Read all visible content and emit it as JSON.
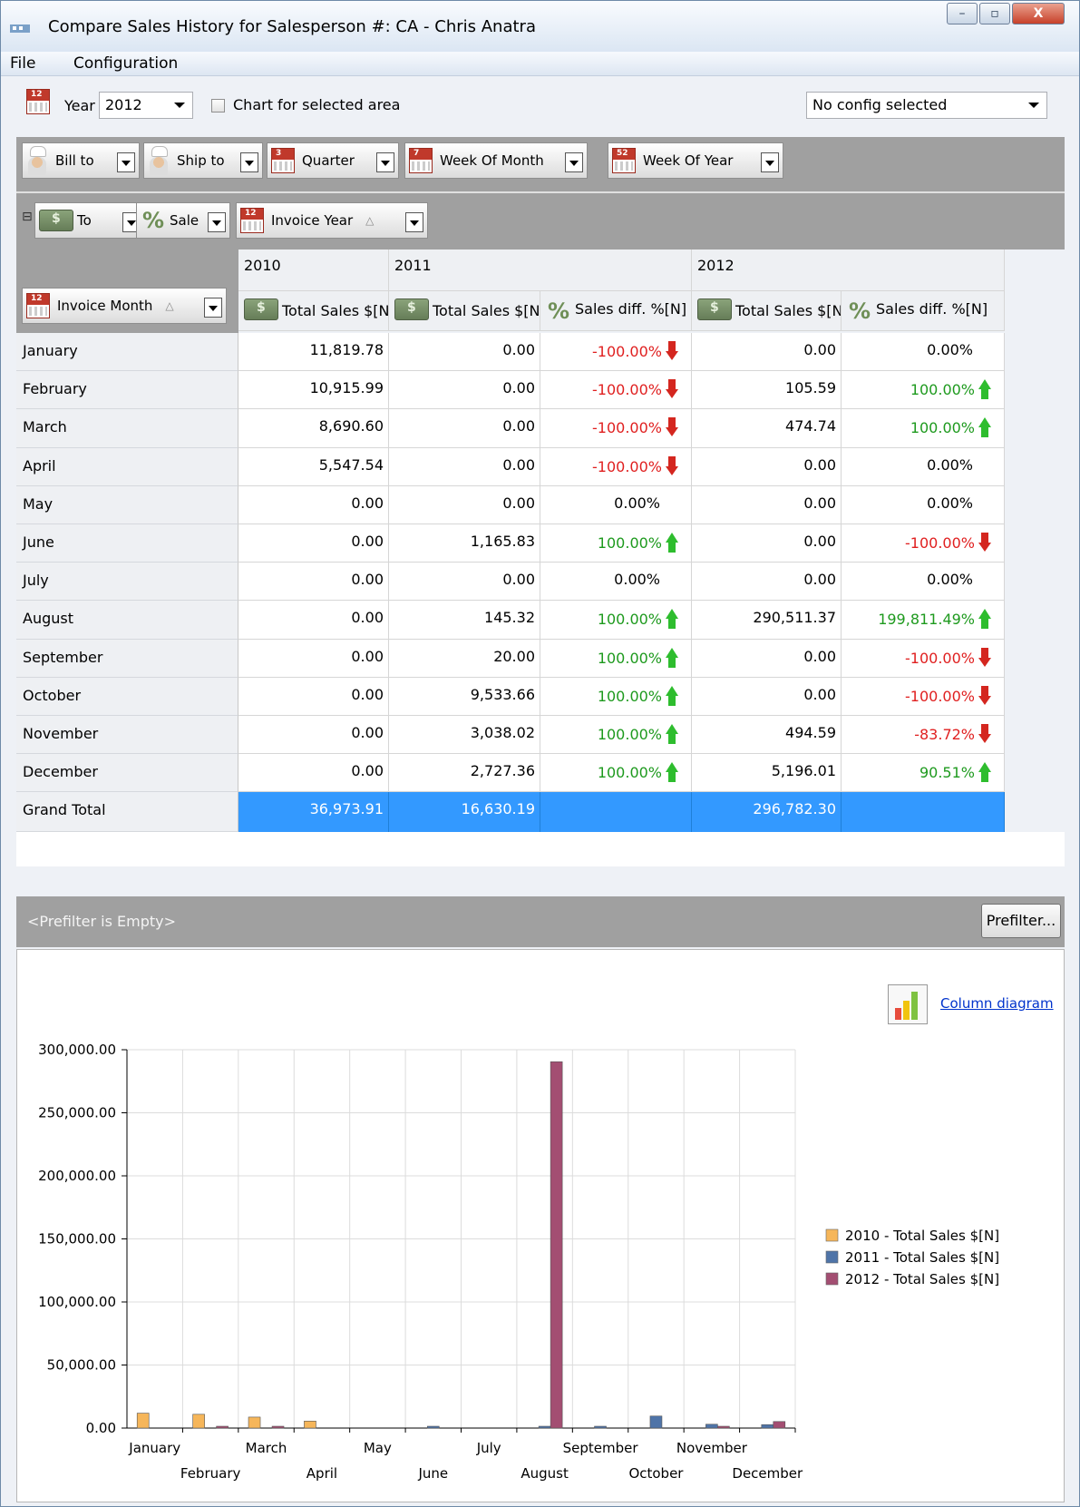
{
  "window": {
    "title": "Compare Sales History for Salesperson #: CA - Chris Anatra",
    "minimize_glyph": "–",
    "maximize_glyph": "▫",
    "close_glyph": "X"
  },
  "menu": {
    "file": "File",
    "configuration": "Configuration"
  },
  "toolbar": {
    "year_label": "Year",
    "year_value": "2012",
    "chart_selected_label": "Chart for selected area",
    "config_value": "No config selected"
  },
  "filter_fields": [
    {
      "label": "Bill to",
      "icon": "person-icon"
    },
    {
      "label": "Ship to",
      "icon": "person-icon"
    },
    {
      "label": "Quarter",
      "icon": "calendar-icon",
      "icon_text": "3"
    },
    {
      "label": "Week Of Month",
      "icon": "calendar-icon",
      "icon_text": "7"
    },
    {
      "label": "Week Of Year",
      "icon": "calendar-icon",
      "icon_text": "52"
    }
  ],
  "data_fields": {
    "collapse_glyph": "⊟",
    "total_short": "To",
    "sales_short": "Sale",
    "invoice_year": "Invoice Year",
    "invoice_month": "Invoice Month",
    "sort_glyph": "△"
  },
  "calendar_icon_text": "12",
  "pivot": {
    "years": [
      "2010",
      "2011",
      "2012"
    ],
    "measure_headers": [
      "Total Sales $[N]",
      "Total Sales $[N]",
      "Sales diff. %[N]",
      "Total Sales $[N]",
      "Sales diff. %[N]"
    ],
    "rows": [
      {
        "month": "January",
        "t2010": "11,819.78",
        "t2011": "0.00",
        "d2011": "-100.00%",
        "d2011_dir": "down",
        "t2012": "0.00",
        "d2012": "0.00%",
        "d2012_dir": "none"
      },
      {
        "month": "February",
        "t2010": "10,915.99",
        "t2011": "0.00",
        "d2011": "-100.00%",
        "d2011_dir": "down",
        "t2012": "105.59",
        "d2012": "100.00%",
        "d2012_dir": "up"
      },
      {
        "month": "March",
        "t2010": "8,690.60",
        "t2011": "0.00",
        "d2011": "-100.00%",
        "d2011_dir": "down",
        "t2012": "474.74",
        "d2012": "100.00%",
        "d2012_dir": "up"
      },
      {
        "month": "April",
        "t2010": "5,547.54",
        "t2011": "0.00",
        "d2011": "-100.00%",
        "d2011_dir": "down",
        "t2012": "0.00",
        "d2012": "0.00%",
        "d2012_dir": "none"
      },
      {
        "month": "May",
        "t2010": "0.00",
        "t2011": "0.00",
        "d2011": "0.00%",
        "d2011_dir": "none",
        "t2012": "0.00",
        "d2012": "0.00%",
        "d2012_dir": "none"
      },
      {
        "month": "June",
        "t2010": "0.00",
        "t2011": "1,165.83",
        "d2011": "100.00%",
        "d2011_dir": "up",
        "t2012": "0.00",
        "d2012": "-100.00%",
        "d2012_dir": "down"
      },
      {
        "month": "July",
        "t2010": "0.00",
        "t2011": "0.00",
        "d2011": "0.00%",
        "d2011_dir": "none",
        "t2012": "0.00",
        "d2012": "0.00%",
        "d2012_dir": "none"
      },
      {
        "month": "August",
        "t2010": "0.00",
        "t2011": "145.32",
        "d2011": "100.00%",
        "d2011_dir": "up",
        "t2012": "290,511.37",
        "d2012": "199,811.49%",
        "d2012_dir": "up"
      },
      {
        "month": "September",
        "t2010": "0.00",
        "t2011": "20.00",
        "d2011": "100.00%",
        "d2011_dir": "up",
        "t2012": "0.00",
        "d2012": "-100.00%",
        "d2012_dir": "down"
      },
      {
        "month": "October",
        "t2010": "0.00",
        "t2011": "9,533.66",
        "d2011": "100.00%",
        "d2011_dir": "up",
        "t2012": "0.00",
        "d2012": "-100.00%",
        "d2012_dir": "down"
      },
      {
        "month": "November",
        "t2010": "0.00",
        "t2011": "3,038.02",
        "d2011": "100.00%",
        "d2011_dir": "up",
        "t2012": "494.59",
        "d2012": "-83.72%",
        "d2012_dir": "down"
      },
      {
        "month": "December",
        "t2010": "0.00",
        "t2011": "2,727.36",
        "d2011": "100.00%",
        "d2011_dir": "up",
        "t2012": "5,196.01",
        "d2012": "90.51%",
        "d2012_dir": "up"
      }
    ],
    "grand_total": {
      "label": "Grand Total",
      "t2010": "36,973.91",
      "t2011": "16,630.19",
      "t2012": "296,782.30"
    }
  },
  "prefilter": {
    "status": "<Prefilter is Empty>",
    "button": "Prefilter..."
  },
  "chart_type_link": "Column diagram",
  "colors": {
    "s2010": "#f6b65a",
    "s2011": "#4f74a8",
    "s2012": "#a34e72",
    "neg": "#e02020",
    "pos": "#1e9a1e",
    "selection": "#3399ff"
  },
  "chart_data": {
    "type": "bar",
    "categories": [
      "January",
      "February",
      "March",
      "April",
      "May",
      "June",
      "July",
      "August",
      "September",
      "October",
      "November",
      "December"
    ],
    "series": [
      {
        "name": "2010 - Total Sales $[N]",
        "values": [
          11819.78,
          10915.99,
          8690.6,
          5547.54,
          0,
          0,
          0,
          0,
          0,
          0,
          0,
          0
        ]
      },
      {
        "name": "2011 - Total Sales $[N]",
        "values": [
          0,
          0,
          0,
          0,
          0,
          1165.83,
          0,
          145.32,
          20.0,
          9533.66,
          3038.02,
          2727.36
        ]
      },
      {
        "name": "2012 - Total Sales $[N]",
        "values": [
          0,
          105.59,
          474.74,
          0,
          0,
          0,
          0,
          290511.37,
          0,
          0,
          494.59,
          5196.01
        ]
      }
    ],
    "ylim": [
      0,
      300000
    ],
    "yticks": [
      "0.00",
      "50,000.00",
      "100,000.00",
      "150,000.00",
      "200,000.00",
      "250,000.00",
      "300,000.00"
    ],
    "ytick_values": [
      0,
      50000,
      100000,
      150000,
      200000,
      250000,
      300000
    ],
    "grid": true,
    "legend": "right"
  }
}
